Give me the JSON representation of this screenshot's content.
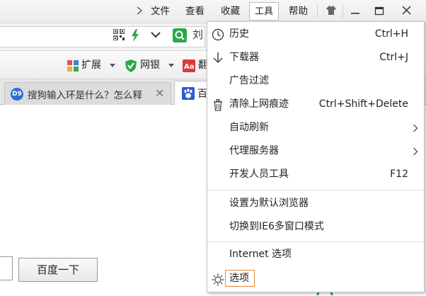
{
  "titlebar": {
    "menus": [
      "文件",
      "查看",
      "收藏",
      "工具",
      "帮助"
    ]
  },
  "address_bar": {
    "search_text": "刘"
  },
  "toolbar": {
    "extensions_label": "扩展",
    "netbank_label": "网银",
    "translate_label": "翻"
  },
  "tabs": [
    {
      "favicon": "D9",
      "title": "搜狗输入环是什么？怎么释"
    },
    {
      "title": "百"
    }
  ],
  "page": {
    "search_button_label": "百度一下"
  },
  "tools_menu": {
    "items": [
      {
        "label": "历史",
        "shortcut": "Ctrl+H",
        "icon": "history-clock-icon"
      },
      {
        "label": "下载器",
        "shortcut": "Ctrl+J",
        "icon": "download-arrow-icon"
      },
      {
        "label": "广告过滤",
        "shortcut": ""
      },
      {
        "label": "清除上网痕迹",
        "shortcut": "Ctrl+Shift+Delete",
        "icon": "trash-icon"
      },
      {
        "label": "自动刷新",
        "submenu": true
      },
      {
        "label": "代理服务器",
        "submenu": true
      },
      {
        "label": "开发人员工具",
        "shortcut": "F12"
      },
      {
        "label": "设置为默认浏览器",
        "shortcut": ""
      },
      {
        "label": "切换到IE6多窗口模式",
        "shortcut": ""
      },
      {
        "label": "Internet 选项",
        "shortcut": ""
      },
      {
        "label": "选项",
        "shortcut": "",
        "icon": "gear-icon",
        "highlighted": true
      }
    ]
  },
  "colors": {
    "highlight_outline": "#e7893a",
    "menu_border": "#c2c2c2"
  }
}
